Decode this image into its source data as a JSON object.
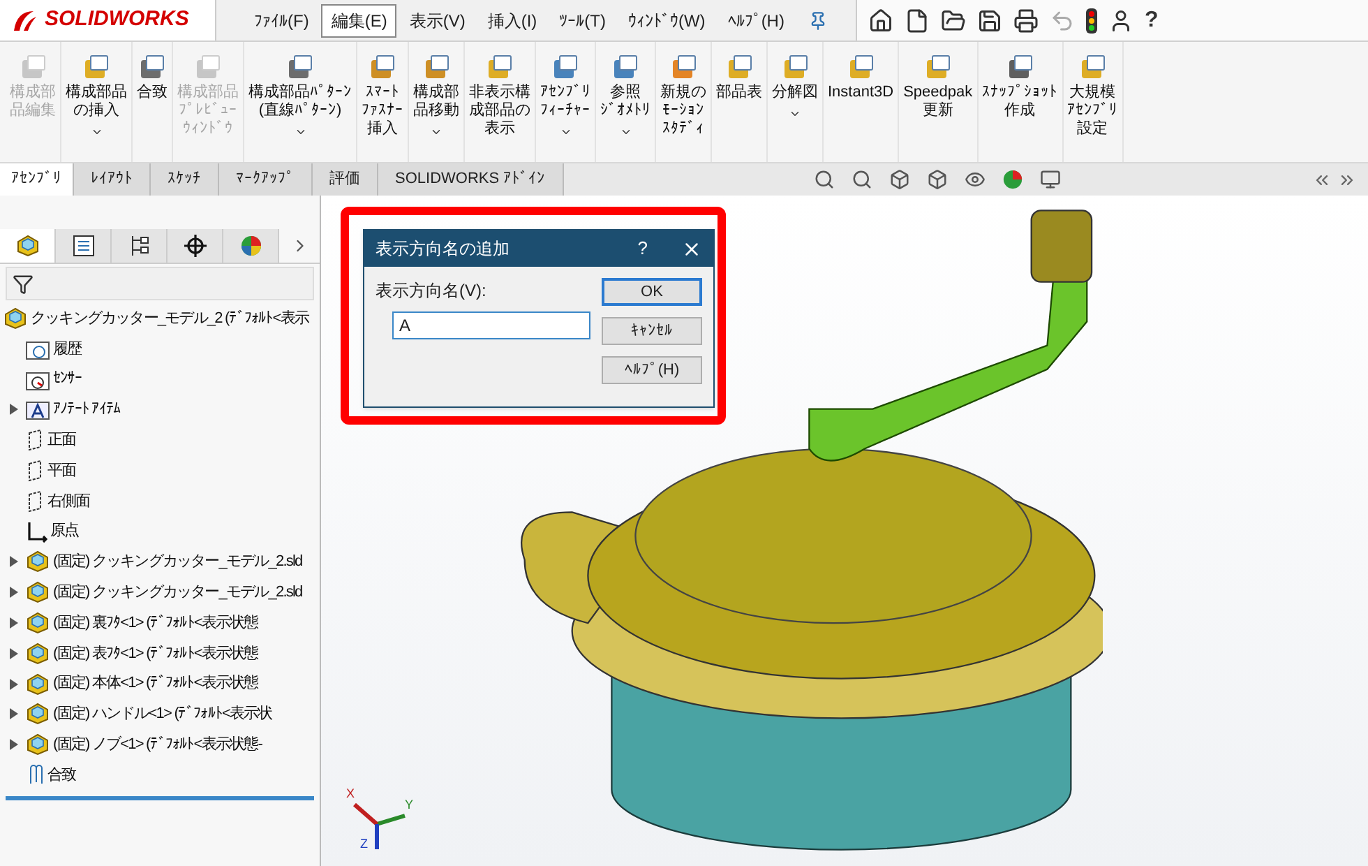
{
  "app": {
    "logo": "SOLIDWORKS"
  },
  "menu": [
    {
      "label": "ﾌｧｲﾙ(F)",
      "selected": false
    },
    {
      "label": "編集(E)",
      "selected": true
    },
    {
      "label": "表示(V)",
      "selected": false
    },
    {
      "label": "挿入(I)",
      "selected": false
    },
    {
      "label": "ﾂｰﾙ(T)",
      "selected": false
    },
    {
      "label": "ｳｨﾝﾄﾞｳ(W)",
      "selected": false
    },
    {
      "label": "ﾍﾙﾌﾟ(H)",
      "selected": false
    }
  ],
  "quick_access": {
    "help": "?"
  },
  "ribbon": [
    {
      "lines": [
        "構成部",
        "品編集"
      ],
      "disabled": true,
      "caret": false
    },
    {
      "lines": [
        "構成部品",
        "の挿入"
      ],
      "disabled": false,
      "caret": true
    },
    {
      "lines": [
        "合致"
      ],
      "disabled": false,
      "caret": false
    },
    {
      "lines": [
        "構成部品",
        "ﾌﾟﾚﾋﾞｭｰ",
        "ｳｨﾝﾄﾞｳ"
      ],
      "disabled": true,
      "caret": false
    },
    {
      "lines": [
        "構成部品ﾊﾟﾀｰﾝ",
        "(直線ﾊﾟﾀｰﾝ)"
      ],
      "disabled": false,
      "caret": true
    },
    {
      "lines": [
        "ｽﾏｰﾄ",
        "ﾌｧｽﾅｰ",
        "挿入"
      ],
      "disabled": false,
      "caret": false
    },
    {
      "lines": [
        "構成部",
        "品移動"
      ],
      "disabled": false,
      "caret": true
    },
    {
      "lines": [
        "非表示構",
        "成部品の",
        "表示"
      ],
      "disabled": false,
      "caret": false
    },
    {
      "lines": [
        "ｱｾﾝﾌﾞﾘ",
        "ﾌｨｰﾁｬｰ"
      ],
      "disabled": false,
      "caret": true
    },
    {
      "lines": [
        "参照",
        "ｼﾞｵﾒﾄﾘ"
      ],
      "disabled": false,
      "caret": true
    },
    {
      "lines": [
        "新規の",
        "ﾓｰｼｮﾝ",
        "ｽﾀﾃﾞｨ"
      ],
      "disabled": false,
      "caret": false
    },
    {
      "lines": [
        "部品表"
      ],
      "disabled": false,
      "caret": false
    },
    {
      "lines": [
        "分解図"
      ],
      "disabled": false,
      "caret": true
    },
    {
      "lines": [
        "Instant3D"
      ],
      "disabled": false,
      "caret": false
    },
    {
      "lines": [
        "Speedpak",
        "更新"
      ],
      "disabled": false,
      "caret": false
    },
    {
      "lines": [
        "ｽﾅｯﾌﾟｼｮｯﾄ",
        "作成"
      ],
      "disabled": false,
      "caret": false
    },
    {
      "lines": [
        "大規模",
        "ｱｾﾝﾌﾞﾘ",
        "設定"
      ],
      "disabled": false,
      "caret": false
    }
  ],
  "tabs": [
    {
      "label": "ｱｾﾝﾌﾞﾘ",
      "selected": true
    },
    {
      "label": "ﾚｲｱｳﾄ",
      "selected": false
    },
    {
      "label": "ｽｹｯﾁ",
      "selected": false
    },
    {
      "label": "ﾏｰｸｱｯﾌﾟ",
      "selected": false
    },
    {
      "label": "評価",
      "selected": false
    },
    {
      "label": "SOLIDWORKS ｱﾄﾞｲﾝ",
      "selected": false
    }
  ],
  "panel_tabs": [
    {
      "selected": true
    },
    {
      "selected": false
    },
    {
      "selected": false
    },
    {
      "selected": false
    },
    {
      "selected": false
    }
  ],
  "tree": [
    {
      "label": "クッキングカッター_モデル_2 (ﾃﾞﾌｫﾙﾄ<表示",
      "kind": "part",
      "children": [
        {
          "label": "履歴",
          "kind": "history",
          "expandable": false
        },
        {
          "label": "ｾﾝｻｰ",
          "kind": "sensor",
          "expandable": false
        },
        {
          "label": "ｱﾉﾃｰﾄ ｱｲﾃﾑ",
          "kind": "annotation",
          "expandable": true
        },
        {
          "label": "正面",
          "kind": "plane",
          "expandable": false
        },
        {
          "label": "平面",
          "kind": "plane",
          "expandable": false
        },
        {
          "label": "右側面",
          "kind": "plane",
          "expandable": false
        },
        {
          "label": "原点",
          "kind": "origin",
          "expandable": false
        },
        {
          "label": "(固定) クッキングカッター_モデル_2.sld",
          "kind": "part",
          "expandable": true
        },
        {
          "label": "(固定) クッキングカッター_モデル_2.sld",
          "kind": "part",
          "expandable": true
        },
        {
          "label": "(固定) 裏ﾌﾀ<1> (ﾃﾞﾌｫﾙﾄ<表示状態",
          "kind": "part",
          "expandable": true
        },
        {
          "label": "(固定) 表ﾌﾀ<1> (ﾃﾞﾌｫﾙﾄ<表示状態",
          "kind": "part",
          "expandable": true
        },
        {
          "label": "(固定) 本体<1> (ﾃﾞﾌｫﾙﾄ<表示状態",
          "kind": "part",
          "expandable": true
        },
        {
          "label": "(固定) ハンドル<1> (ﾃﾞﾌｫﾙﾄ<表示状",
          "kind": "part",
          "expandable": true
        },
        {
          "label": "(固定) ノブ<1> (ﾃﾞﾌｫﾙﾄ<表示状態-",
          "kind": "part",
          "expandable": true
        },
        {
          "label": "合致",
          "kind": "mate",
          "expandable": false
        }
      ]
    }
  ],
  "dialog": {
    "title": "表示方向名の追加",
    "help": "?",
    "field_label": "表示方向名(V):",
    "value": "A",
    "buttons": [
      {
        "label": "OK",
        "default": true
      },
      {
        "label": "ｷｬﾝｾﾙ",
        "default": false
      },
      {
        "label": "ﾍﾙﾌﾟ(H)",
        "default": false
      }
    ]
  },
  "triad": [
    "X",
    "Y",
    "Z"
  ]
}
